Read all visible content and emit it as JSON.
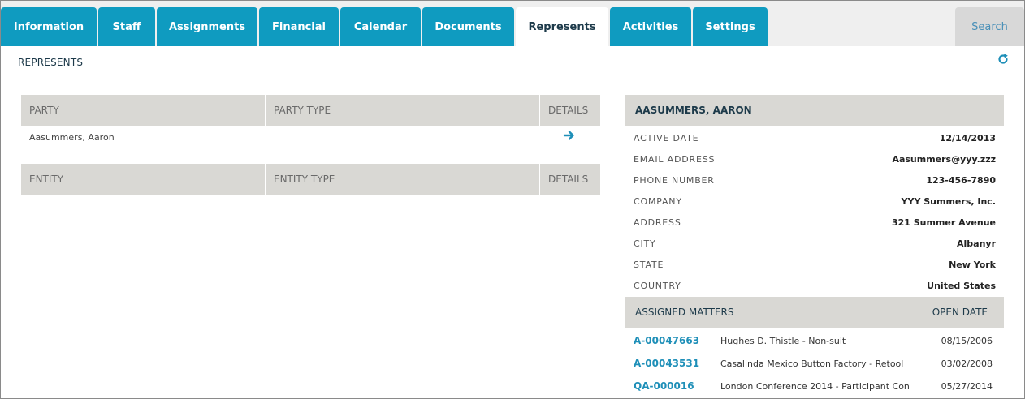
{
  "tabs": [
    {
      "label": "Information"
    },
    {
      "label": "Staff"
    },
    {
      "label": "Assignments"
    },
    {
      "label": "Financial"
    },
    {
      "label": "Calendar"
    },
    {
      "label": "Documents"
    },
    {
      "label": "Represents",
      "active": true
    },
    {
      "label": "Activities"
    },
    {
      "label": "Settings"
    }
  ],
  "search_label": "Search",
  "page_title": "REPRESENTS",
  "icons": {
    "refresh": "refresh-icon",
    "details": "arrow-right-icon"
  },
  "colors": {
    "accent": "#0f9bc0",
    "header_bg": "#d9d8d4",
    "link": "#1e8fb8"
  },
  "party_table": {
    "headers": [
      "PARTY",
      "PARTY TYPE",
      "DETAILS"
    ],
    "rows": [
      {
        "party": "Aasummers, Aaron",
        "type": ""
      }
    ]
  },
  "entity_table": {
    "headers": [
      "ENTITY",
      "ENTITY TYPE",
      "DETAILS"
    ],
    "rows": []
  },
  "detail": {
    "name": "AASUMMERS, AARON",
    "fields": [
      {
        "label": "ACTIVE DATE",
        "value": "12/14/2013"
      },
      {
        "label": "EMAIL ADDRESS",
        "value": "Aasummers@yyy.zzz"
      },
      {
        "label": "PHONE NUMBER",
        "value": "123-456-7890"
      },
      {
        "label": "COMPANY",
        "value": "YYY Summers, Inc."
      },
      {
        "label": "ADDRESS",
        "value": "321 Summer Avenue"
      },
      {
        "label": "CITY",
        "value": "Albanyr"
      },
      {
        "label": "STATE",
        "value": "New York"
      },
      {
        "label": "COUNTRY",
        "value": "United States"
      }
    ]
  },
  "matters": {
    "header_left": "ASSIGNED MATTERS",
    "header_right": "OPEN DATE",
    "rows": [
      {
        "code": "A-00047663",
        "desc": "Hughes D. Thistle - Non-suit",
        "date": "08/15/2006"
      },
      {
        "code": "A-00043531",
        "desc": "Casalinda Mexico Button Factory - Retool",
        "date": "03/02/2008"
      },
      {
        "code": "QA-000016",
        "desc": "London Conference 2014 - Participant Con",
        "date": "05/27/2014"
      }
    ]
  }
}
